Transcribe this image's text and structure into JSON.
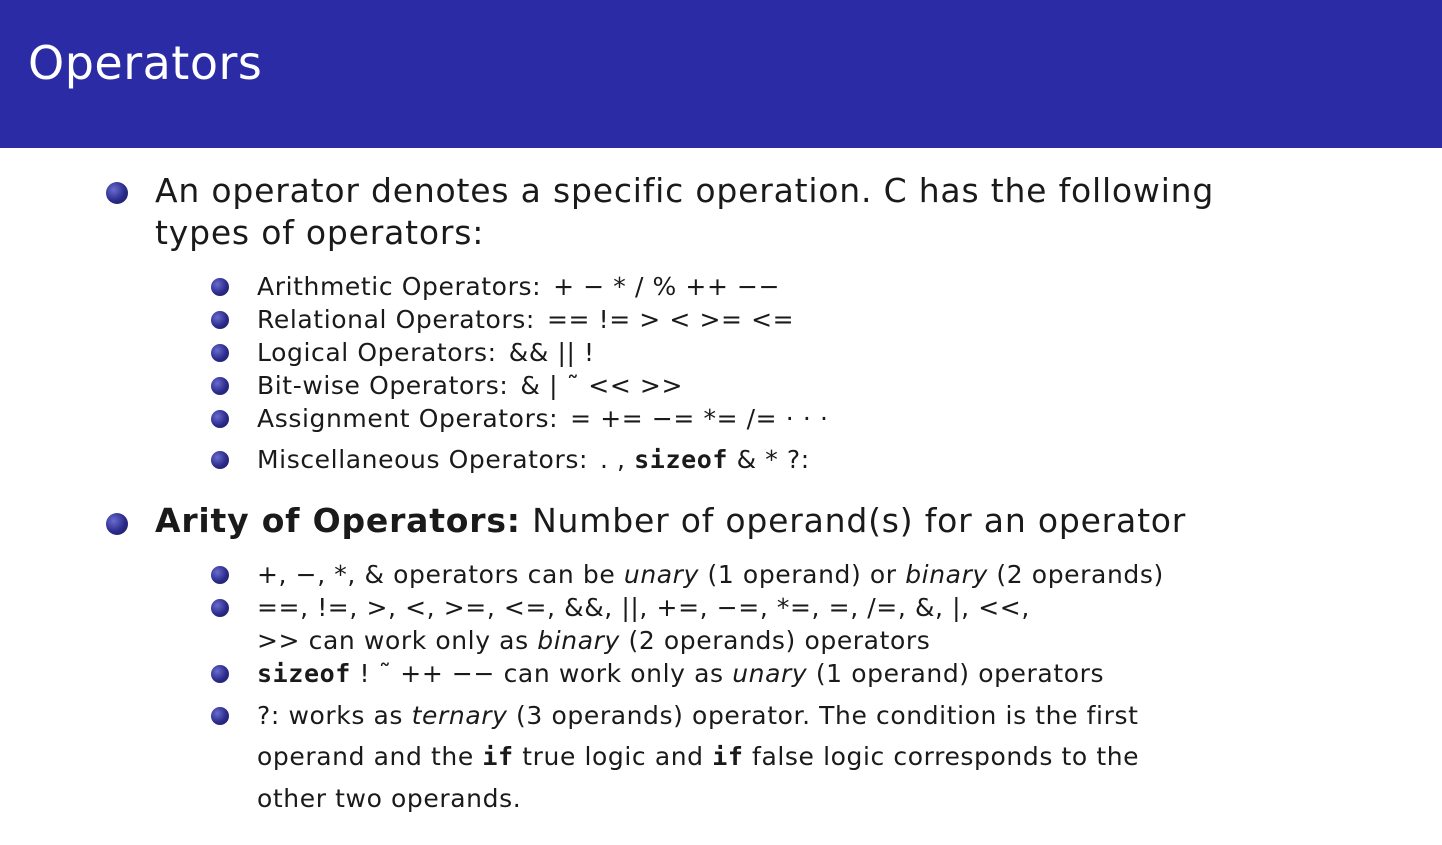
{
  "header": {
    "title": "Operators"
  },
  "intro": {
    "line1": "An operator denotes a specific operation.  C has the following",
    "line2": "types of operators:"
  },
  "types": [
    {
      "label": "Arithmetic Operators:",
      "ops": "+  −  *  /  %  ++  −−"
    },
    {
      "label": "Relational Operators:",
      "ops": "==  !=  >  <  >=  <="
    },
    {
      "label": "Logical Operators:",
      "ops": "&&  ||  !"
    },
    {
      "label": "Bit-wise Operators:",
      "ops": "&  |  ˜  <<  >>"
    },
    {
      "label": "Assignment Operators:",
      "ops": "=  +=  −=  *=  /=  · · ·"
    },
    {
      "label": "Miscellaneous Operators:",
      "ops_pre": ".   ,  ",
      "ops_mono": "sizeof",
      "ops_post": "  &  *  ?:"
    }
  ],
  "arity": {
    "title": "Arity of Operators:",
    "desc": " Number of operand(s) for an operator",
    "items": {
      "unary_binary": {
        "a": "+, −, *, & operators can be ",
        "b": "unary",
        "c": " (1 operand) or ",
        "d": "binary",
        "e": " (2 operands)"
      },
      "binary_only": {
        "line1": "==, !=, >, <, >=, <=, &&, ||, +=, −=, *=, =, /=, &, |, <<,",
        "line2a": ">> can work only as ",
        "line2b": "binary",
        "line2c": " (2 operands) operators"
      },
      "unary_only": {
        "mono": "sizeof",
        "a": " !  ˜  ++  −− can work only as ",
        "b": "unary",
        "c": " (1 operand) operators"
      },
      "ternary": {
        "line1a": "?: works as ",
        "line1b": "ternary",
        "line1c": " (3 operands) operator.  The condition is the first",
        "line2a": "operand and the ",
        "line2b": "if",
        "line2c": " true logic and ",
        "line2d": "if",
        "line2e": " false logic corresponds to the",
        "line3": "other two operands."
      }
    }
  }
}
